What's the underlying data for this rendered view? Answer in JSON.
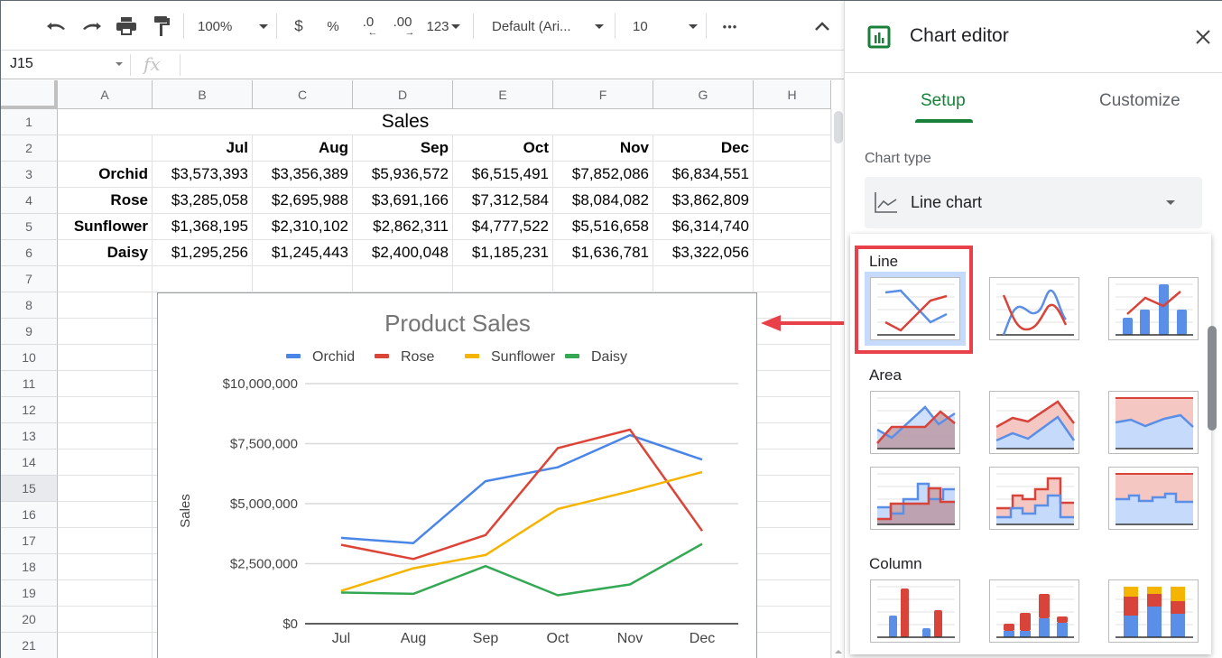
{
  "toolbar": {
    "zoom": "100%",
    "currency_symbol": "$",
    "percent_symbol": "%",
    "decrease_decimals": ".0",
    "increase_decimals": ".00",
    "more_formats": "123",
    "font_family": "Default (Ari...",
    "font_size": "10",
    "more": "•••"
  },
  "formula_bar": {
    "cell_reference": "J15",
    "fx_symbol": "fx",
    "value": ""
  },
  "grid": {
    "columns": [
      "A",
      "B",
      "C",
      "D",
      "E",
      "F",
      "G",
      "H"
    ],
    "rows": [
      "1",
      "2",
      "3",
      "4",
      "5",
      "6",
      "7",
      "8",
      "9",
      "10",
      "11",
      "12",
      "13",
      "14",
      "15",
      "16",
      "17",
      "18",
      "19",
      "20",
      "21"
    ],
    "selected_row": "15",
    "title": "Sales",
    "months": [
      "Jul",
      "Aug",
      "Sep",
      "Oct",
      "Nov",
      "Dec"
    ],
    "products": [
      {
        "name": "Orchid",
        "values": [
          "$3,573,393",
          "$3,356,389",
          "$5,936,572",
          "$6,515,491",
          "$7,852,086",
          "$6,834,551"
        ]
      },
      {
        "name": "Rose",
        "values": [
          "$3,285,058",
          "$2,695,988",
          "$3,691,166",
          "$7,312,584",
          "$8,084,082",
          "$3,862,809"
        ]
      },
      {
        "name": "Sunflower",
        "values": [
          "$1,368,195",
          "$2,310,102",
          "$2,862,311",
          "$4,777,522",
          "$5,516,658",
          "$6,314,740"
        ]
      },
      {
        "name": "Daisy",
        "values": [
          "$1,295,256",
          "$1,245,443",
          "$2,400,048",
          "$1,185,231",
          "$1,636,781",
          "$3,322,056"
        ]
      }
    ]
  },
  "chart_data": {
    "type": "line",
    "title": "Product Sales",
    "xlabel": "",
    "ylabel": "Sales",
    "categories": [
      "Jul",
      "Aug",
      "Sep",
      "Oct",
      "Nov",
      "Dec"
    ],
    "ylim": [
      0,
      10000000
    ],
    "yticks": [
      0,
      2500000,
      5000000,
      7500000,
      10000000
    ],
    "ytick_labels": [
      "$0",
      "$2,500,000",
      "$5,000,000",
      "$7,500,000",
      "$10,000,000"
    ],
    "grid": true,
    "legend_position": "top",
    "series": [
      {
        "name": "Orchid",
        "color": "#4a86e8",
        "values": [
          3573393,
          3356389,
          5936572,
          6515491,
          7852086,
          6834551
        ]
      },
      {
        "name": "Rose",
        "color": "#db4437",
        "values": [
          3285058,
          2695988,
          3691166,
          7312584,
          8084082,
          3862809
        ]
      },
      {
        "name": "Sunflower",
        "color": "#f4b400",
        "values": [
          1368195,
          2310102,
          2862311,
          4777522,
          5516658,
          6314740
        ]
      },
      {
        "name": "Daisy",
        "color": "#34a853",
        "values": [
          1295256,
          1245443,
          2400048,
          1185231,
          1636781,
          3322056
        ]
      }
    ]
  },
  "panel": {
    "title": "Chart editor",
    "tabs": [
      {
        "label": "Setup",
        "active": true
      },
      {
        "label": "Customize",
        "active": false
      }
    ],
    "chart_type_label": "Chart type",
    "chart_type_value": "Line chart",
    "accent_color": "#188038"
  },
  "dropdown": {
    "sections": [
      {
        "heading": "Line",
        "options": [
          "Line chart",
          "Smooth line chart",
          "Combo chart"
        ],
        "selected": "Line chart"
      },
      {
        "heading": "Area",
        "options": [
          "Area chart",
          "Stacked area chart",
          "100% stacked area chart",
          "Stepped area chart",
          "Stacked stepped area chart",
          "100% stacked stepped area chart"
        ]
      },
      {
        "heading": "Column",
        "options": [
          "Column chart",
          "Stacked column chart",
          "100% stacked column chart"
        ]
      }
    ],
    "highlight_color": "#e8414a"
  }
}
